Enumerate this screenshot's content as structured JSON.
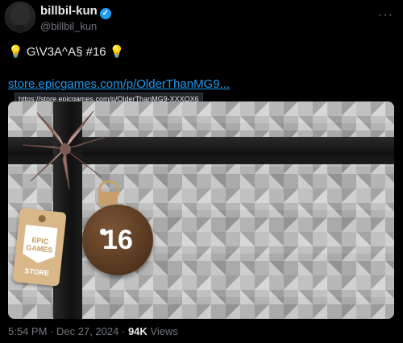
{
  "author": {
    "display_name": "billbil-kun",
    "handle": "@billbil_kun",
    "verified_icon": "verified-badge-icon"
  },
  "menu_icon": "more-options-icon",
  "tweet": {
    "bulb_left": "💡",
    "text": "G\\V3A^A§ #16",
    "bulb_right": "💡",
    "link_text": "store.epicgames.com/p/OlderThanMG9...",
    "link_tooltip": "https://store.epicgames.com/p/OlderThanMG9-XXXOX6"
  },
  "image": {
    "tag_brand_line1": "EPIC",
    "tag_brand_line2": "GAMES",
    "tag_store": "STORE",
    "ornament_number": "16"
  },
  "meta": {
    "time": "5:54 PM",
    "sep1": "·",
    "date": "Dec 27, 2024",
    "sep2": "·",
    "views_count": "94K",
    "views_label": "Views"
  },
  "colors": {
    "background": "#000000",
    "text": "#e7e9ea",
    "muted": "#71767b",
    "link": "#1d9bf0",
    "ornament": "#5c3c22",
    "tag": "#d8b789"
  }
}
